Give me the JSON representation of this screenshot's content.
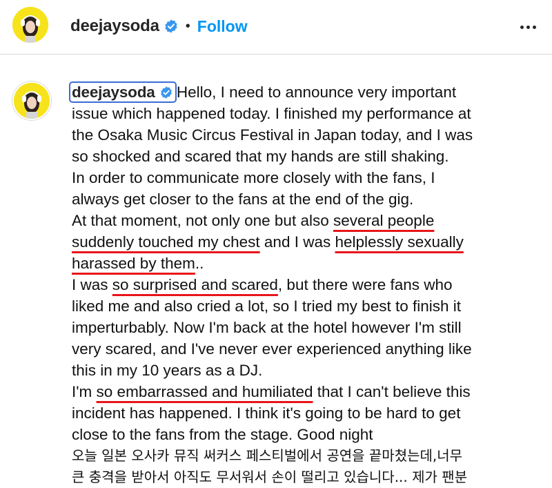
{
  "post": {
    "username": "deejaysoda",
    "follow_label": "Follow",
    "separator": "•",
    "more_icon": "ellipsis-icon",
    "verified_icon": "verified-badge-icon"
  },
  "colors": {
    "follow": "#0095f6",
    "verified": "#3897f0",
    "underline": "#e8141a",
    "username_highlight_border": "#3b6bd6",
    "avatar_bg": "#f7e31c"
  },
  "caption": {
    "username": "deejaysoda",
    "lines": [
      [
        {
          "t": "Hello, I need to announce very important"
        }
      ],
      [
        {
          "t": "issue which happened today. I finished my performance at"
        }
      ],
      [
        {
          "t": "the Osaka Music Circus Festival in Japan today, and I was"
        }
      ],
      [
        {
          "t": "so shocked and scared that my hands are still shaking."
        }
      ],
      [
        {
          "t": "In order to communicate more closely with the fans, I"
        }
      ],
      [
        {
          "t": "always get closer to the fans at the end of the gig."
        }
      ],
      [
        {
          "t": "At that moment, not only one but also "
        },
        {
          "t": "several people",
          "u": true
        }
      ],
      [
        {
          "t": "suddenly touched my chest",
          "u": true
        },
        {
          "t": " and I was "
        },
        {
          "t": "helplessly sexually",
          "u": true
        }
      ],
      [
        {
          "t": "harassed by them",
          "u": true
        },
        {
          "t": ".."
        }
      ],
      [
        {
          "t": "I was "
        },
        {
          "t": "so surprised and scared",
          "u": true
        },
        {
          "t": ", but there were fans who"
        }
      ],
      [
        {
          "t": "liked me and also cried a lot, so I tried my best to finish it"
        }
      ],
      [
        {
          "t": "imperturbably. Now I'm back at the hotel however I'm still"
        }
      ],
      [
        {
          "t": "very scared, and I've never ever experienced anything like"
        }
      ],
      [
        {
          "t": "this in my 10 years as a DJ."
        }
      ],
      [
        {
          "t": "I'm "
        },
        {
          "t": "so embarrassed and humiliated",
          "u": true
        },
        {
          "t": " that I can't believe this"
        }
      ],
      [
        {
          "t": "incident has happened. I think it's going to be hard to get"
        }
      ],
      [
        {
          "t": "close to the fans from the stage. Good night"
        }
      ],
      [
        {
          "t": "오늘 일본 오사카 뮤직 써커스 페스티벌에서 공연을 끝마쳤는데,너무",
          "ko": true
        }
      ],
      [
        {
          "t": "큰 충격을 받아서 아직도 무서워서 손이 떨리고 있습니다... 제가 팬분",
          "ko": true
        }
      ]
    ]
  }
}
